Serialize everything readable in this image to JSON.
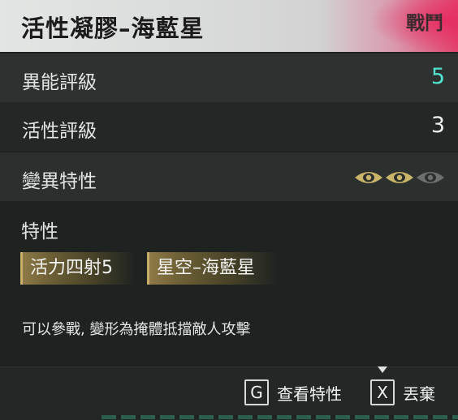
{
  "header": {
    "title": "活性凝膠–海藍星",
    "tag": "戰鬥"
  },
  "stats": {
    "ability_label": "異能評級",
    "ability_value": "5",
    "activity_label": "活性評級",
    "activity_value": "3",
    "mutation_label": "變異特性",
    "mutation_level": 2,
    "mutation_max": 3
  },
  "traits": {
    "section_label": "特性",
    "items": [
      {
        "label": "活力四射5"
      },
      {
        "label": "星空–海藍星"
      }
    ]
  },
  "description": "可以參戰, 變形為掩體抵擋敵人攻擊",
  "footer": {
    "view_key": "G",
    "view_label": "查看特性",
    "discard_key": "X",
    "discard_label": "丟棄"
  },
  "colors": {
    "accent_cyan": "#52e3cf",
    "eye_active": "#c9b46a",
    "eye_inactive": "#6b6f6e",
    "header_accent": "#e2426c"
  }
}
